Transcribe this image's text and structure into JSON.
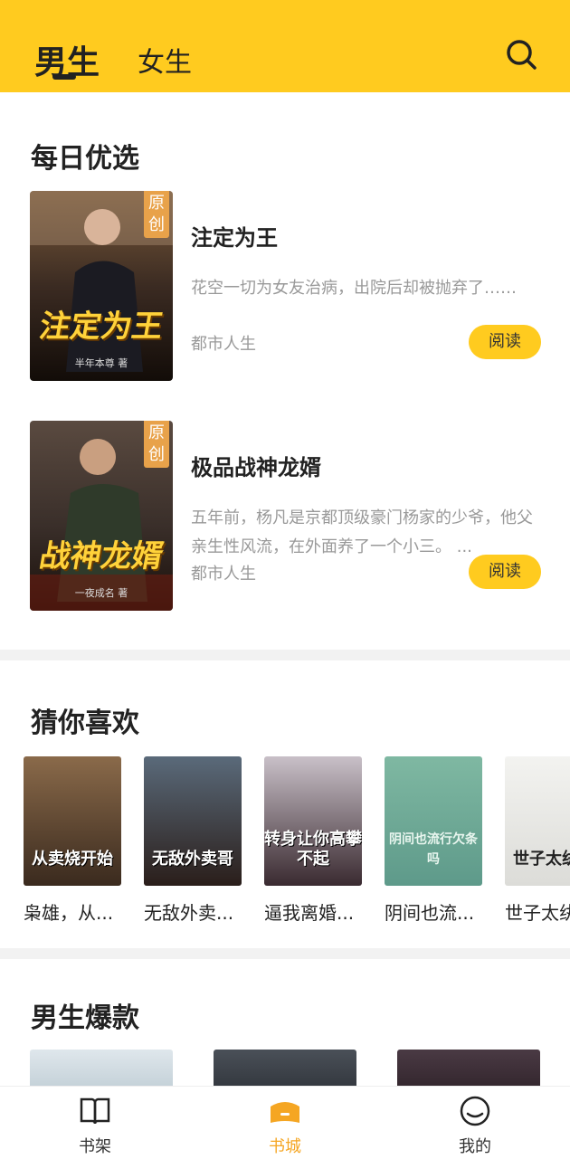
{
  "header": {
    "tabs": [
      {
        "label": "男生",
        "active": true
      },
      {
        "label": "女生",
        "active": false
      }
    ],
    "icon": "search-icon"
  },
  "daily": {
    "title": "每日优选",
    "books": [
      {
        "badge": "原创",
        "cover_text": "注定为王",
        "cover_sub": "半年本尊 著",
        "title": "注定为王",
        "desc": "花空一切为女友治病，出院后却被抛弃了……",
        "category": "都市人生",
        "button": "阅读"
      },
      {
        "badge": "原创",
        "cover_text": "战神龙婿",
        "cover_sub": "一夜成名 著",
        "title": "极品战神龙婿",
        "desc": "五年前，杨凡是京都顶级豪门杨家的少爷，他父亲生性风流，在外面养了一个小三。 ...",
        "category": "都市人生",
        "button": "阅读"
      }
    ]
  },
  "guess": {
    "title": "猜你喜欢",
    "books": [
      {
        "title": "枭雄，从...",
        "cover_text": "从卖烧开始"
      },
      {
        "title": "无敌外卖...",
        "cover_text": "无敌外卖哥"
      },
      {
        "title": "逼我离婚...",
        "cover_text": "转身让你高攀不起"
      },
      {
        "title": "阴间也流...",
        "cover_text": "阴间也流行欠条吗"
      },
      {
        "title": "世子太纨",
        "cover_text": "世子太纨绔"
      }
    ]
  },
  "hot": {
    "title": "男生爆款"
  },
  "bottom_nav": [
    {
      "label": "书架",
      "icon": "book-icon",
      "active": false
    },
    {
      "label": "书城",
      "icon": "store-icon",
      "active": true
    },
    {
      "label": "我的",
      "icon": "profile-icon",
      "active": false
    }
  ],
  "colors": {
    "accent": "#FFCB1F",
    "active_nav": "#F5A623",
    "muted_text": "#999999"
  }
}
